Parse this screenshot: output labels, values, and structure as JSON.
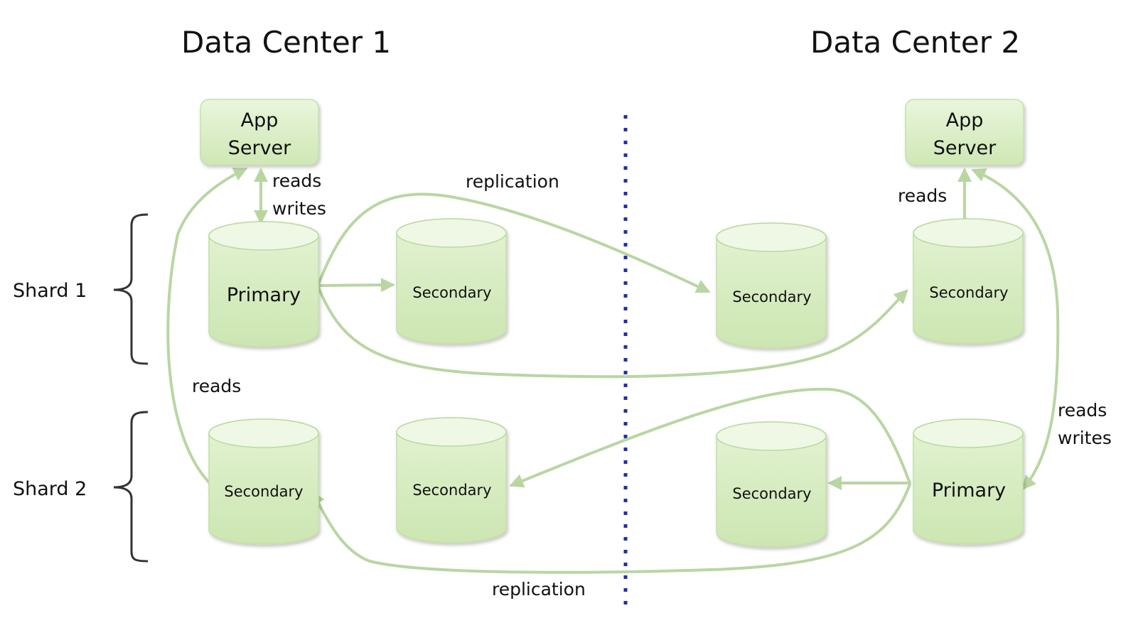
{
  "data_centers": [
    {
      "title": "Data Center 1"
    },
    {
      "title": "Data Center 2"
    }
  ],
  "app_servers": [
    {
      "line1": "App",
      "line2": "Server"
    },
    {
      "line1": "App",
      "line2": "Server"
    }
  ],
  "shards": [
    {
      "label": "Shard 1"
    },
    {
      "label": "Shard 2"
    }
  ],
  "nodes": {
    "s1_dc1_primary": "Primary",
    "s1_dc1_secondary": "Secondary",
    "s1_dc2_secondary_a": "Secondary",
    "s1_dc2_secondary_b": "Secondary",
    "s2_dc1_secondary_a": "Secondary",
    "s2_dc1_secondary_b": "Secondary",
    "s2_dc2_secondary": "Secondary",
    "s2_dc2_primary": "Primary"
  },
  "edge_labels": {
    "dc1_app_rw_1": "reads",
    "dc1_app_rw_2": "writes",
    "replication_top": "replication",
    "dc2_app_reads": "reads",
    "dc1_reads": "reads",
    "dc2_rw_1": "reads",
    "dc2_rw_2": "writes",
    "replication_bottom": "replication"
  },
  "colors": {
    "node_fill_top": "#eef8e4",
    "node_fill_bottom": "#cde6b2",
    "edge": "#b9d6a2",
    "divider": "#1f2fa6"
  }
}
